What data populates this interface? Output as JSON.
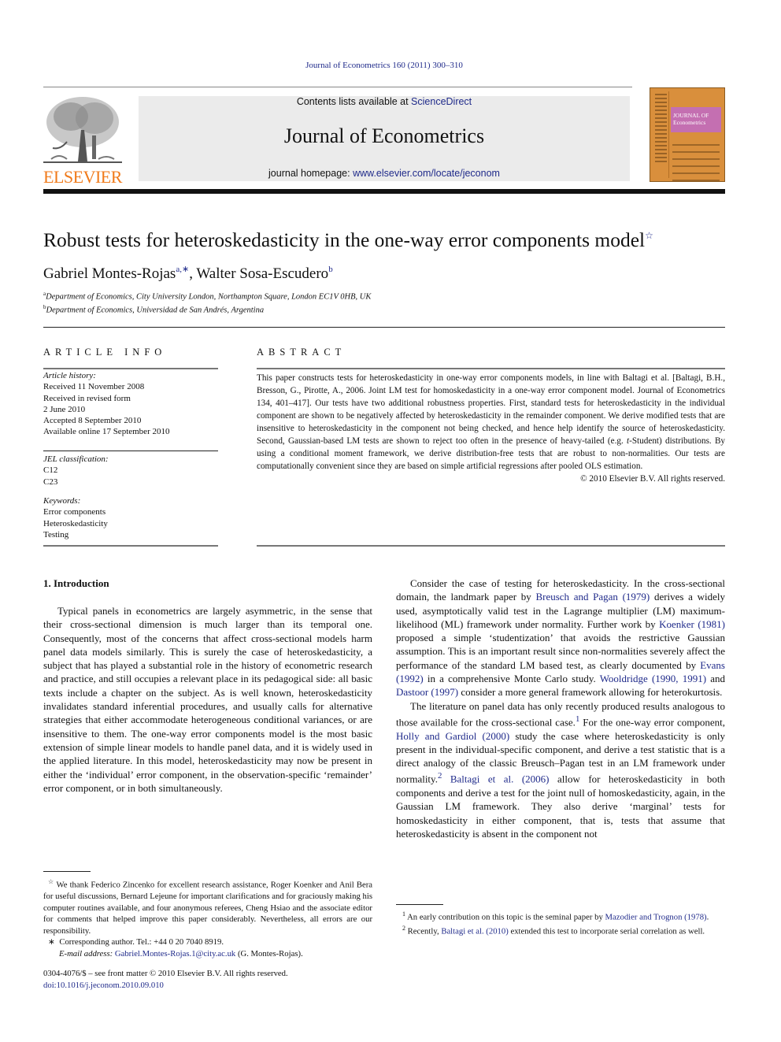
{
  "header": {
    "citation": "Journal of Econometrics 160 (2011) 300–310",
    "contents_prefix": "Contents lists available at ",
    "contents_link": "ScienceDirect",
    "journal_name": "Journal of Econometrics",
    "homepage_prefix": "journal homepage: ",
    "homepage_link": "www.elsevier.com/locate/jeconom",
    "publisher_logo_text": "ELSEVIER",
    "cover_title_line1": "JOURNAL OF",
    "cover_title_line2": "Econometrics"
  },
  "colors": {
    "link": "#1f2a8a",
    "elsevier_orange": "#f07a1a",
    "cover_orange": "#d98f3c",
    "cover_band": "#c46fb1",
    "header_band": "#ebebeb"
  },
  "article": {
    "title": "Robust tests for heteroskedasticity in the one-way error components model",
    "title_marker": "☆",
    "authors": [
      {
        "name": "Gabriel Montes-Rojas",
        "sup": "a,∗"
      },
      {
        "name": "Walter Sosa-Escudero",
        "sup": "b"
      }
    ],
    "author_separator": ", ",
    "affiliations": [
      {
        "sup": "a",
        "text": "Department of Economics, City University London, Northampton Square, London EC1V 0HB, UK"
      },
      {
        "sup": "b",
        "text": "Department of Economics, Universidad de San Andrés, Argentina"
      }
    ]
  },
  "article_info": {
    "heading": "ARTICLE INFO",
    "history_label": "Article history:",
    "history": [
      "Received 11 November 2008",
      "Received in revised form",
      "2 June 2010",
      "Accepted 8 September 2010",
      "Available online 17 September 2010"
    ],
    "jel_label": "JEL classification:",
    "jel": [
      "C12",
      "C23"
    ],
    "keywords_label": "Keywords:",
    "keywords": [
      "Error components",
      "Heteroskedasticity",
      "Testing"
    ]
  },
  "abstract": {
    "heading": "ABSTRACT",
    "text_part1": "This paper constructs tests for heteroskedasticity in one-way error components models, in line with Baltagi et al. [Baltagi, B.H., Bresson, G., Pirotte, A., 2006. Joint LM test for homoskedasticity in a one-way error component model. Journal of Econometrics 134, 401–417]. Our tests have two additional robustness properties. First, standard tests for heteroskedasticity in the individual component are shown to be negatively affected by heteroskedasticity in the remainder component. We derive modified tests that are insensitive to heteroskedasticity in the component not being checked, and hence help identify the source of heteroskedasticity. Second, Gaussian-based LM tests are shown to reject too often in the presence of heavy-tailed (e.g. ",
    "text_italic": "t",
    "text_part2": "-Student) distributions. By using a conditional moment framework, we derive distribution-free tests that are robust to non-normalities. Our tests are computationally convenient since they are based on simple artificial regressions after pooled OLS estimation.",
    "copyright": "© 2010 Elsevier B.V. All rights reserved."
  },
  "intro": {
    "heading": "1.  Introduction",
    "left_paragraph": "Typical panels in econometrics are largely asymmetric, in the sense that their cross-sectional dimension is much larger than its temporal one. Consequently, most of the concerns that affect cross-sectional models harm panel data models similarly. This is surely the case of heteroskedasticity, a subject that has played a substantial role in the history of econometric research and practice, and still occupies a relevant place in its pedagogical side: all basic texts include a chapter on the subject. As is well known, heteroskedasticity invalidates standard inferential procedures, and usually calls for alternative strategies that either accommodate heterogeneous conditional variances, or are insensitive to them. The one-way error components model is the most basic extension of simple linear models to handle panel data, and it is widely used in the applied literature. In this model, heteroskedasticity may now be present in either the ‘individual’ error component, in the observation-specific ‘remainder’ error component, or in both simultaneously.",
    "right_p1": {
      "t1": "Consider the case of testing for heteroskedasticity. In the cross-sectional domain, the landmark paper by ",
      "l1": "Breusch and Pagan (1979)",
      "t2": " derives a widely used, asymptotically valid test in the Lagrange multiplier (LM) maximum-likelihood (ML) framework under normality. Further work by ",
      "l2": "Koenker (1981)",
      "t3": " proposed a simple ‘studentization’ that avoids the restrictive Gaussian assumption. This is an important result since non-normalities severely affect the performance of the standard LM based test, as clearly documented by ",
      "l3": "Evans (1992)",
      "t4": " in a comprehensive Monte Carlo study. ",
      "l4": "Wooldridge (1990, 1991)",
      "t5": " and ",
      "l5": "Dastoor (1997)",
      "t6": " consider a more general framework allowing for heterokurtosis."
    },
    "right_p2": {
      "t1": "The literature on panel data has only recently produced results analogous to those available for the cross-sectional case.",
      "fn1": "1",
      "t2": " For the one-way error component, ",
      "l1": "Holly and Gardiol (2000)",
      "t3": " study the case where heteroskedasticity is only present in the individual-specific component, and derive a test statistic that is a direct analogy of the classic Breusch–Pagan test in an LM framework under normality.",
      "fn2": "2",
      "t4": " ",
      "l2": "Baltagi et al. (2006)",
      "t5": " allow for heteroskedasticity in both components and derive a test for the joint null of homoskedasticity, again, in the Gaussian LM framework. They also derive ‘marginal’ tests for homoskedasticity in either component, that is, tests that assume that heteroskedasticity is absent in the component not"
    }
  },
  "footnotes_left": {
    "star_marker": "☆",
    "star_text": "We thank Federico Zincenko for excellent research assistance, Roger Koenker and Anil Bera for useful discussions, Bernard Lejeune for important clarifications and for graciously making his computer routines available, and four anonymous referees, Cheng Hsiao and the associate editor for comments that helped improve this paper considerably. Nevertheless, all errors are our responsibility.",
    "corr_marker": "∗",
    "corr_text": "Corresponding author. Tel.: +44 0 20 7040 8919.",
    "email_label": "E-mail address:",
    "email": "Gabriel.Montes-Rojas.1@city.ac.uk",
    "email_suffix": " (G. Montes-Rojas)."
  },
  "footnotes_right": [
    {
      "num": "1",
      "text": " An early contribution on this topic is the seminal paper by ",
      "link": "Mazodier and Trognon (1978)",
      "after": "."
    },
    {
      "num": "2",
      "text": " Recently, ",
      "link": "Baltagi et al. (2010)",
      "after": " extended this test to incorporate serial correlation as well."
    }
  ],
  "front_matter": {
    "issn_line": "0304-4076/$ – see front matter © 2010 Elsevier B.V. All rights reserved.",
    "doi": "doi:10.1016/j.jeconom.2010.09.010"
  }
}
